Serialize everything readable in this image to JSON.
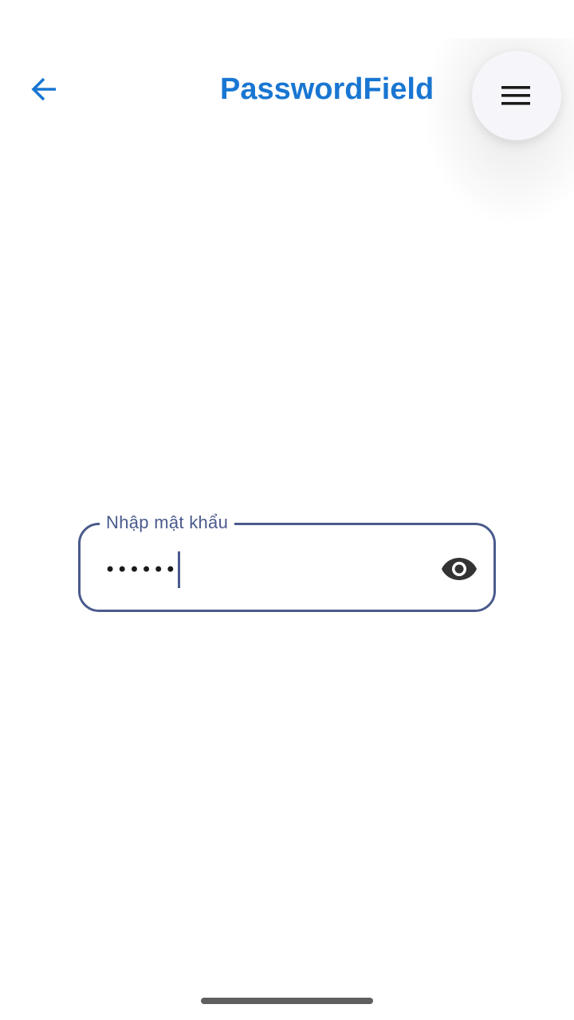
{
  "header": {
    "title": "PasswordField",
    "back_icon": "arrow-left-icon",
    "menu_icon": "hamburger-menu-icon"
  },
  "password_field": {
    "label": "Nhập mật khẩu",
    "masked_value": "••••••",
    "visibility_icon": "eye-icon"
  },
  "colors": {
    "accent": "#1976d2",
    "field_border": "#4a5b8c",
    "menu_bg": "#f6f6fa",
    "icon_dark": "#333333"
  }
}
